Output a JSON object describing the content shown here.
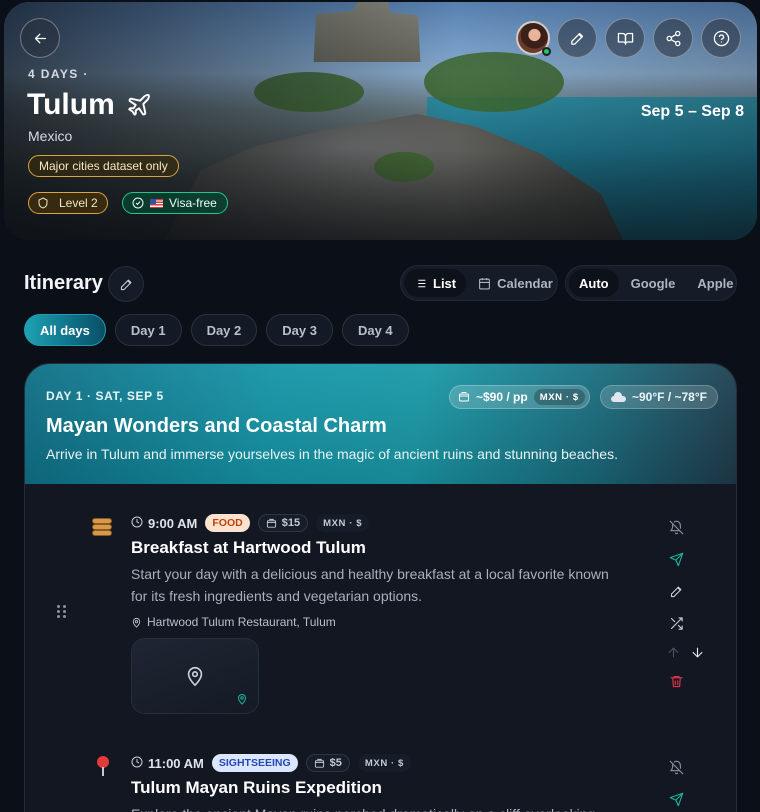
{
  "trip": {
    "days_label": "4 DAYS ·",
    "city": "Tulum",
    "country": "Mexico",
    "dates": "Sep 5 – Sep 8",
    "dataset_note": "Major cities dataset only",
    "level": "Level 2",
    "visa": "Visa-free"
  },
  "itinerary": {
    "title": "Itinerary",
    "view_options": [
      "List",
      "Calendar"
    ],
    "active_view": "List",
    "map_options": [
      "Auto",
      "Google",
      "Apple"
    ],
    "active_map": "Auto",
    "day_tabs": [
      "All days",
      "Day 1",
      "Day 2",
      "Day 3",
      "Day 4"
    ],
    "active_tab": "All days"
  },
  "day": {
    "meta": "DAY 1 · SAT, SEP 5",
    "title": "Mayan Wonders and Coastal Charm",
    "description": "Arrive in Tulum and immerse yourselves in the magic of ancient ruins and stunning beaches.",
    "budget": "~$90 / pp",
    "budget_currency": "MXN · $",
    "weather": "~90°F / ~78°F"
  },
  "activities": [
    {
      "time": "9:00 AM",
      "category": "FOOD",
      "cost": "$15",
      "currency": "MXN · $",
      "title": "Breakfast at Hartwood Tulum",
      "description_lines": [
        "Start your day with a delicious and healthy breakfast at a local favorite known",
        "for its fresh ingredients and vegetarian options."
      ],
      "location": "Hartwood Tulum Restaurant, Tulum",
      "icon": "pancakes-icon"
    },
    {
      "time": "11:00 AM",
      "category": "SIGHTSEEING",
      "cost": "$5",
      "currency": "MXN · $",
      "title": "Tulum Mayan Ruins Expedition",
      "description_lines": [
        "Explore the ancient Mayan ruins perched dramatically on a cliff overlooking"
      ],
      "icon": "pushpin-icon"
    }
  ],
  "colors": {
    "accent_teal": "#1596a8",
    "food_badge": "#fde3cf",
    "sightseeing_badge": "#dbe6ff",
    "delete_red": "#e0344a",
    "send_teal": "#1fb3a0"
  }
}
